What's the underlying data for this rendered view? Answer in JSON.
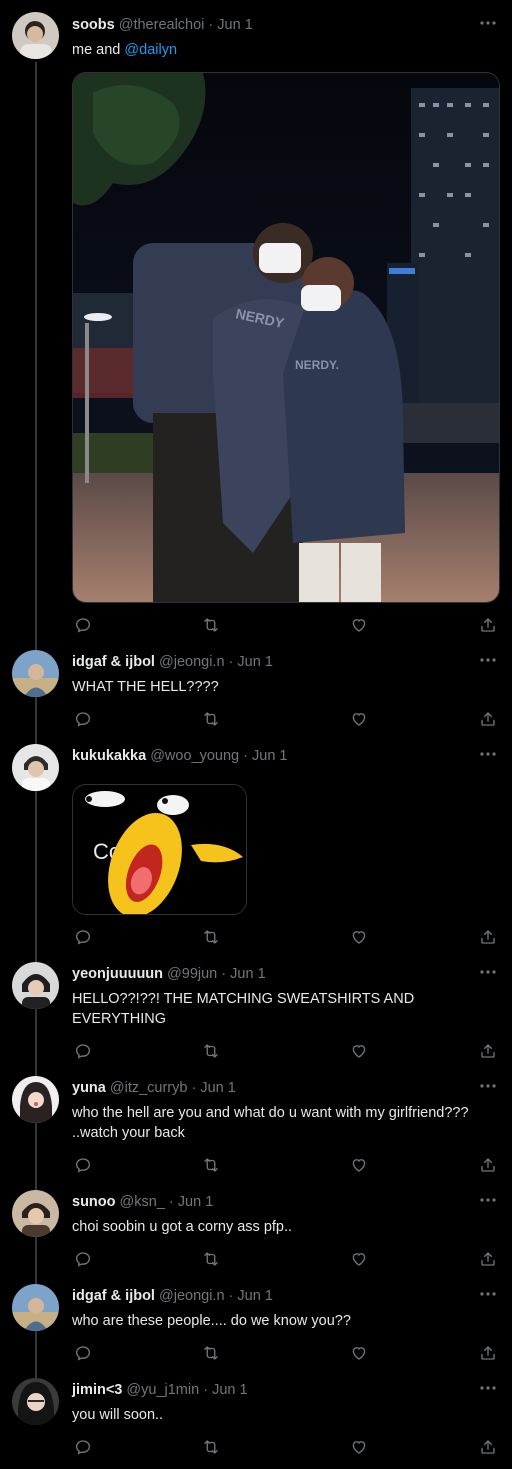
{
  "tweets": [
    {
      "name": "soobs",
      "handle": "@therealchoi",
      "date": "Jun 1",
      "text_prefix": "me and ",
      "mention": "@dailyn",
      "media": {
        "photo_text_a": "NERDY",
        "photo_text_b": "NERDY."
      }
    },
    {
      "name": "idgaf & ijbol",
      "handle": "@jeongi.n",
      "date": "Jun 1",
      "text": "WHAT THE HELL????"
    },
    {
      "name": "kukukakka",
      "handle": "@woo_young",
      "date": "Jun 1",
      "text": "",
      "gif_text": "Coldirbo"
    },
    {
      "name": "yeonjuuuuun",
      "handle": "@99jun",
      "date": "Jun 1",
      "text": "HELLO??!??! THE MATCHING SWEATSHIRTS AND EVERYTHING"
    },
    {
      "name": "yuna",
      "handle": "@itz_curryb",
      "date": "Jun 1",
      "text": "who the hell are you and what do u want with my girlfriend??? ..watch your back"
    },
    {
      "name": "sunoo",
      "handle": "@ksn_",
      "date": "Jun 1",
      "text": "choi soobin u got a corny ass pfp.."
    },
    {
      "name": "idgaf & ijbol",
      "handle": "@jeongi.n",
      "date": "Jun 1",
      "text": "who are these people.... do we know you??"
    },
    {
      "name": "jimin<3",
      "handle": "@yu_j1min",
      "date": "Jun 1",
      "text": "you will soon.."
    }
  ],
  "separator": "·",
  "icons": {
    "reply": "reply-icon",
    "retweet": "retweet-icon",
    "like": "like-icon",
    "share": "share-icon",
    "more": "more-icon"
  },
  "colors": {
    "background": "#000000",
    "text": "#e7e9ea",
    "muted": "#71767b",
    "mention": "#1d9bf0",
    "thread_line": "#333639"
  }
}
